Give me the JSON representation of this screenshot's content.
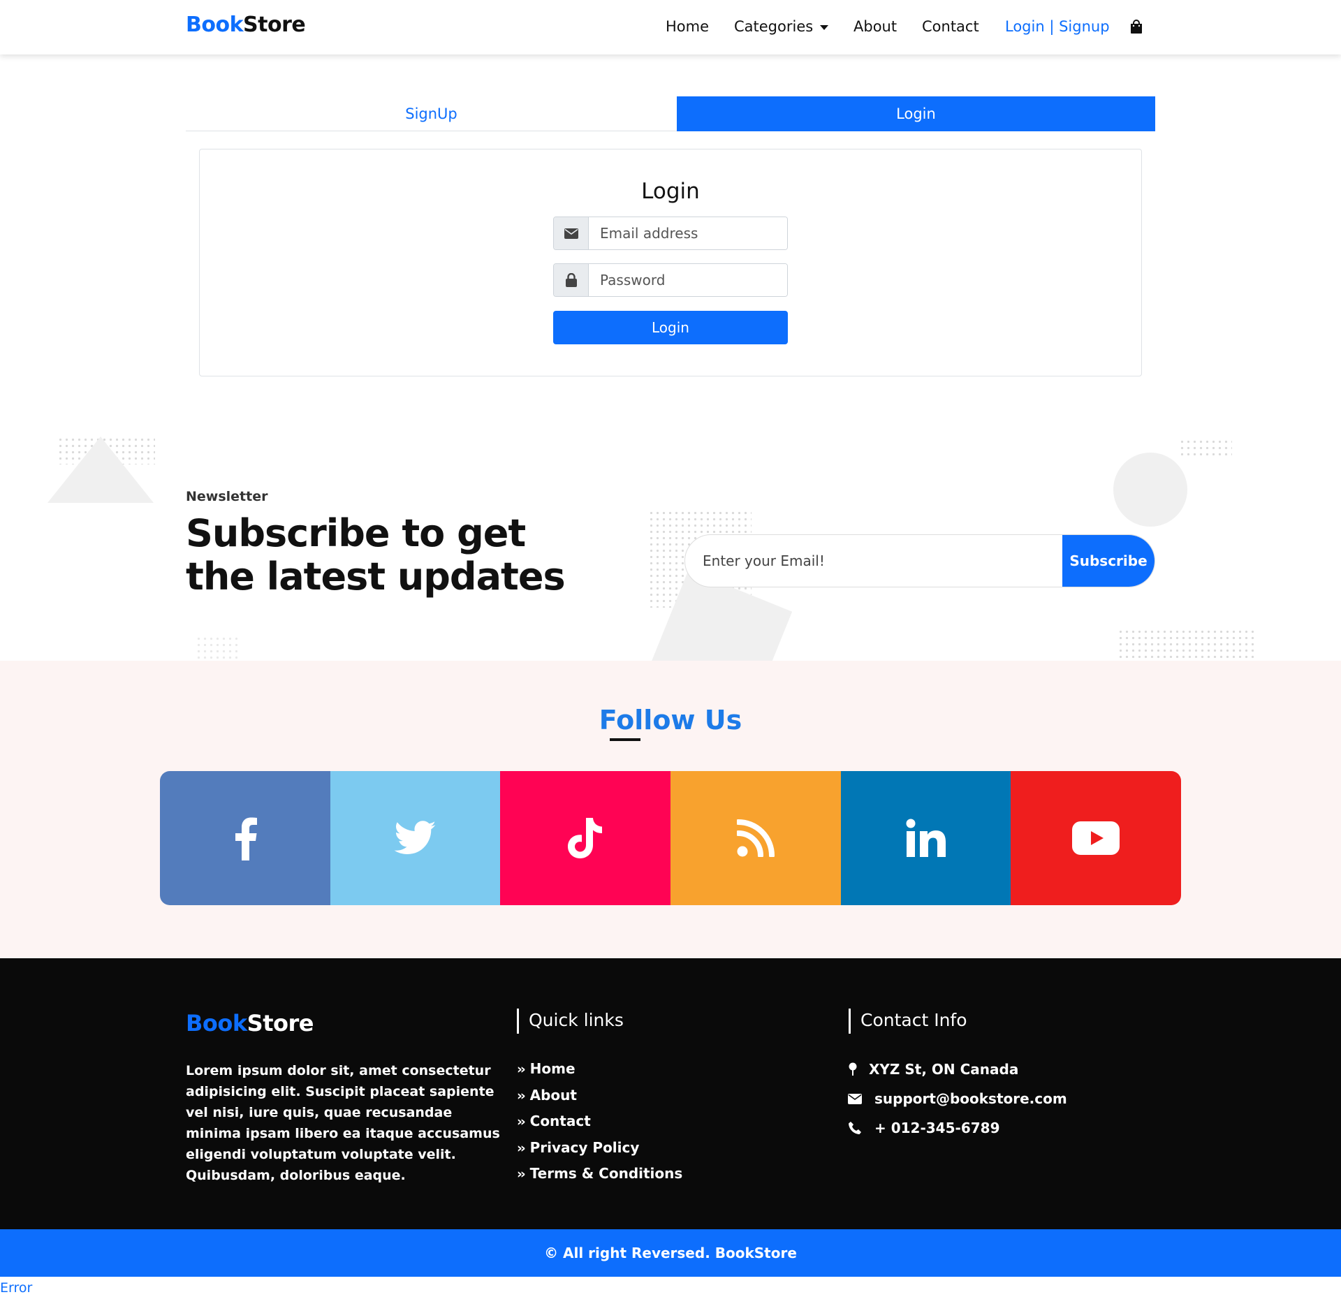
{
  "brand": {
    "part1": "Book",
    "part2": "Store"
  },
  "nav": {
    "home": "Home",
    "categories": "Categories",
    "about": "About",
    "contact": "Contact",
    "login_signup": "Login | Signup"
  },
  "tabs": {
    "signup": "SignUp",
    "login": "Login"
  },
  "login_form": {
    "title": "Login",
    "email_placeholder": "Email address",
    "password_placeholder": "Password",
    "submit_label": "Login"
  },
  "newsletter": {
    "label": "Newsletter",
    "heading": "Subscribe to get the latest updates",
    "email_placeholder": "Enter your Email!",
    "button_label": "Subscribe"
  },
  "follow": {
    "title": "Follow Us",
    "socials": [
      {
        "name": "facebook",
        "color": "#537cbc"
      },
      {
        "name": "twitter",
        "color": "#7ccaf0"
      },
      {
        "name": "tiktok",
        "color": "#ff0354"
      },
      {
        "name": "rss",
        "color": "#f8a22e"
      },
      {
        "name": "linkedin",
        "color": "#0177b5"
      },
      {
        "name": "youtube",
        "color": "#ef1e1e"
      }
    ]
  },
  "footer": {
    "brand_part1": "Book",
    "brand_part2": "Store",
    "about_text": "Lorem ipsum dolor sit, amet consectetur adipisicing elit. Suscipit placeat sapiente vel nisi, iure quis, quae recusandae minima ipsam libero ea itaque accusamus eligendi voluptatum voluptate velit. Quibusdam, doloribus eaque.",
    "quick_links_title": "Quick links",
    "quick_links": [
      "Home",
      "About",
      "Contact",
      "Privacy Policy",
      "Terms & Conditions"
    ],
    "contact_title": "Contact Info",
    "address": "XYZ St, ON Canada",
    "email": "support@bookstore.com",
    "phone": "+ 012-345-6789"
  },
  "copyright": "© All right Reversed.  BookStore",
  "error_text": "Error",
  "colors": {
    "primary": "#0d6efd",
    "follow_bg": "#fdf4f3",
    "footer_bg": "#0a0a0a"
  }
}
